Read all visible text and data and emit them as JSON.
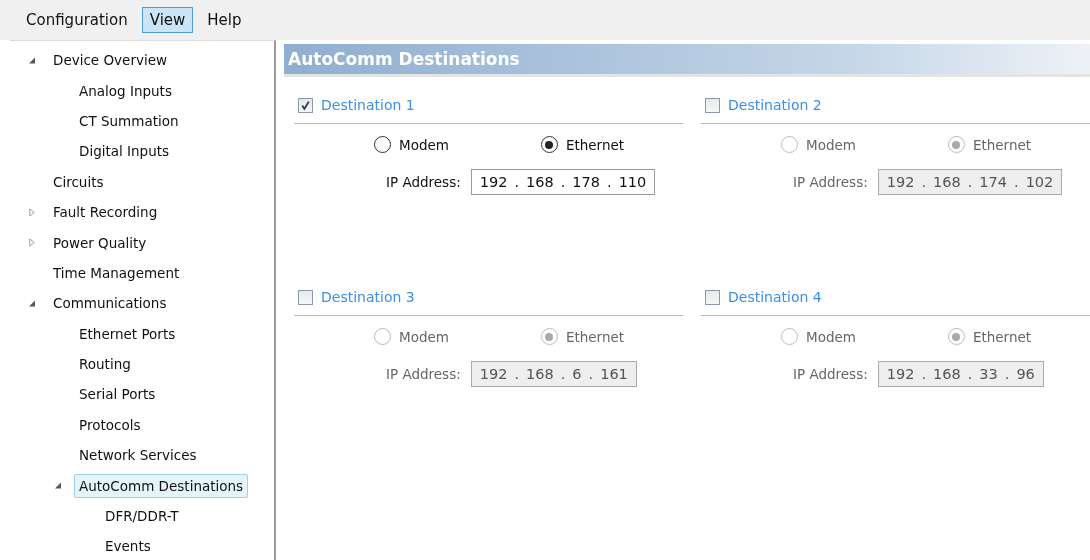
{
  "menu": [
    {
      "label": "Configuration",
      "selected": false
    },
    {
      "label": "View",
      "selected": true
    },
    {
      "label": "Help",
      "selected": false
    }
  ],
  "tree": [
    {
      "label": "Device Overview",
      "expanded": true,
      "selected": false,
      "children": [
        {
          "label": "Analog Inputs",
          "selected": false
        },
        {
          "label": "CT Summation",
          "selected": false
        },
        {
          "label": "Digital Inputs",
          "selected": false
        }
      ]
    },
    {
      "label": "Circuits",
      "selected": false
    },
    {
      "label": "Fault Recording",
      "expanded": false,
      "selected": false
    },
    {
      "label": "Power Quality",
      "expanded": false,
      "selected": false
    },
    {
      "label": "Time Management",
      "selected": false
    },
    {
      "label": "Communications",
      "expanded": true,
      "selected": false,
      "children": [
        {
          "label": "Ethernet Ports",
          "selected": false
        },
        {
          "label": "Routing",
          "selected": false
        },
        {
          "label": "Serial Ports",
          "selected": false
        },
        {
          "label": "Protocols",
          "selected": false
        },
        {
          "label": "Network Services",
          "selected": false
        },
        {
          "label": "AutoComm Destinations",
          "expanded": true,
          "selected": true,
          "children": [
            {
              "label": "DFR/DDR-T",
              "selected": false
            },
            {
              "label": "Events",
              "selected": false
            }
          ]
        }
      ]
    }
  ],
  "panel": {
    "title": "AutoComm Destinations"
  },
  "destinations": [
    {
      "label": "Destination 1",
      "checked": true,
      "options": [
        {
          "label": "Modem",
          "selected": false
        },
        {
          "label": "Ethernet",
          "selected": true
        }
      ],
      "ip_label": "IP Address:",
      "ip": [
        "192",
        "168",
        "178",
        "110"
      ]
    },
    {
      "label": "Destination 2",
      "checked": false,
      "options": [
        {
          "label": "Modem",
          "selected": false
        },
        {
          "label": "Ethernet",
          "selected": true
        }
      ],
      "ip_label": "IP Address:",
      "ip": [
        "192",
        "168",
        "174",
        "102"
      ]
    },
    {
      "label": "Destination 3",
      "checked": false,
      "options": [
        {
          "label": "Modem",
          "selected": false
        },
        {
          "label": "Ethernet",
          "selected": true
        }
      ],
      "ip_label": "IP Address:",
      "ip": [
        "192",
        "168",
        "6",
        "161"
      ]
    },
    {
      "label": "Destination 4",
      "checked": false,
      "options": [
        {
          "label": "Modem",
          "selected": false
        },
        {
          "label": "Ethernet",
          "selected": true
        }
      ],
      "ip_label": "IP Address:",
      "ip": [
        "192",
        "168",
        "33",
        "96"
      ]
    }
  ],
  "ip_separator": "."
}
